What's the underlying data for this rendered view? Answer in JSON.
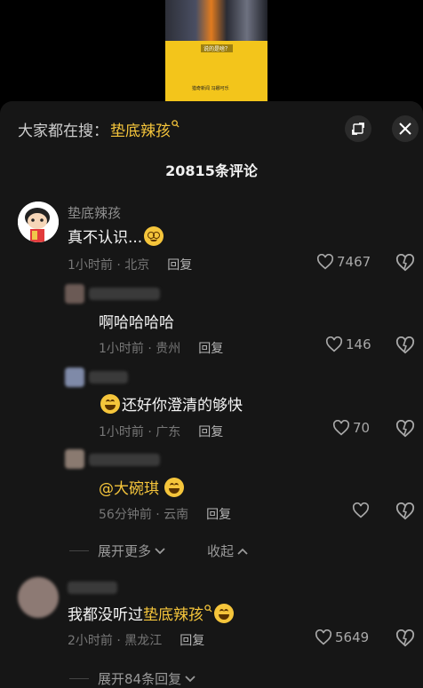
{
  "video": {
    "caption": "说的是啥？",
    "footer": "猎奇新闻 冯娜可乐"
  },
  "header": {
    "search_prefix": "大家都在搜：",
    "search_keyword": "垫底辣孩",
    "comment_count": "20815条评论"
  },
  "comments": [
    {
      "user": "垫底辣孩",
      "text": "真不认识...",
      "time_loc": "1小时前 · 北京",
      "reply": "回复",
      "likes": "7467",
      "replies": [
        {
          "text": "啊哈哈哈哈",
          "time_loc": "1小时前 · 贵州",
          "reply": "回复",
          "likes": "146"
        },
        {
          "text": "还好你澄清的够快",
          "time_loc": "1小时前 · 广东",
          "reply": "回复",
          "likes": "70"
        },
        {
          "text": "@大碗琪",
          "time_loc": "56分钟前 · 云南",
          "reply": "回复",
          "likes": ""
        }
      ],
      "expand_more": "展开更多",
      "collapse": "收起"
    },
    {
      "text_prefix": "我都没听过",
      "text_keyword": "垫底辣孩",
      "time_loc": "2小时前 · 黑龙江",
      "reply": "回复",
      "likes": "5649",
      "expand_replies": "展开84条回复"
    }
  ]
}
